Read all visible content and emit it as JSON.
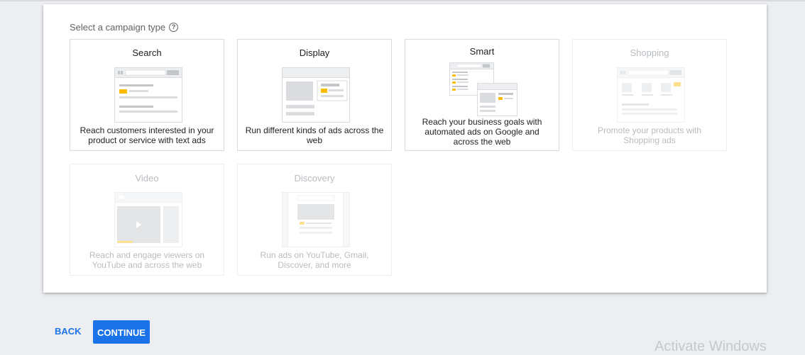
{
  "prompt": {
    "label": "Select a campaign type",
    "help_icon": "help-circle-icon"
  },
  "campaign_types": [
    {
      "title": "Search",
      "description": "Reach customers interested in your product or service with text ads",
      "enabled": true
    },
    {
      "title": "Display",
      "description": "Run different kinds of ads across the web",
      "enabled": true
    },
    {
      "title": "Smart",
      "description": "Reach your business goals with automated ads on Google and across the web",
      "enabled": true
    },
    {
      "title": "Shopping",
      "description": "Promote your products with Shopping ads",
      "enabled": false
    },
    {
      "title": "Video",
      "description": "Reach and engage viewers on YouTube and across the web",
      "enabled": false
    },
    {
      "title": "Discovery",
      "description": "Run ads on YouTube, Gmail, Discover, and more",
      "enabled": false
    }
  ],
  "actions": {
    "back_label": "BACK",
    "continue_label": "CONTINUE"
  },
  "watermark": "Activate Windows",
  "colors": {
    "accent": "#1a73e8",
    "ad_highlight": "#fbbc04",
    "page_background": "#eceef1"
  }
}
